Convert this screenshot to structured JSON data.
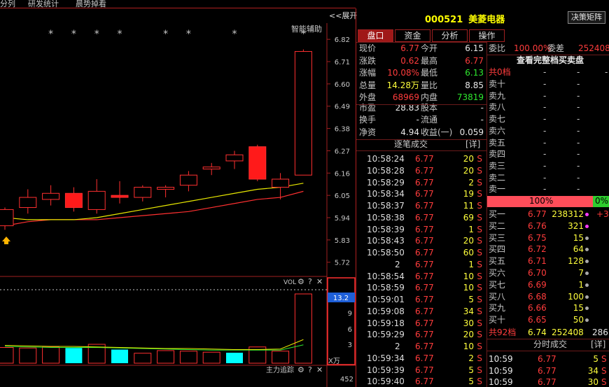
{
  "top_tabs": [
    "分列",
    "研发统计",
    "晨势掉看"
  ],
  "expand_label": "<<展开",
  "chart": {
    "assist_label": "智能辅助",
    "star": "*",
    "price_ticks": [
      "6.82",
      "6.71",
      "6.60",
      "6.49",
      "6.38",
      "6.27",
      "6.16",
      "6.05",
      "5.94",
      "5.83",
      "5.72"
    ],
    "vol_label": "VOL",
    "vol_ticks": [
      "13.2",
      "9",
      "6",
      "3"
    ],
    "vol_unit": "X万",
    "vol_icons": [
      "⚙",
      "?",
      "✕"
    ],
    "tracker_label": "主力追踪",
    "tracker_value": "452",
    "chart_data": {
      "type": "candlestick",
      "ylim": [
        5.65,
        6.9
      ],
      "price_ticks": [
        6.82,
        6.71,
        6.6,
        6.49,
        6.38,
        6.27,
        6.16,
        6.05,
        5.94,
        5.83,
        5.72
      ],
      "candles": [
        {
          "o": 5.9,
          "c": 5.98,
          "h": 5.99,
          "l": 5.88,
          "up": false
        },
        {
          "o": 6.04,
          "c": 5.99,
          "h": 6.08,
          "l": 5.96,
          "up": false
        },
        {
          "o": 6.06,
          "c": 6.03,
          "h": 6.1,
          "l": 6.0,
          "up": false
        },
        {
          "o": 6.06,
          "c": 5.99,
          "h": 6.09,
          "l": 5.97,
          "up": true
        },
        {
          "o": 6.07,
          "c": 5.98,
          "h": 6.13,
          "l": 5.96,
          "up": false
        },
        {
          "o": 6.05,
          "c": 6.04,
          "h": 6.12,
          "l": 6.01,
          "up": true
        },
        {
          "o": 6.09,
          "c": 6.04,
          "h": 6.1,
          "l": 6.02,
          "up": false
        },
        {
          "o": 6.09,
          "c": 6.08,
          "h": 6.1,
          "l": 6.04,
          "up": false
        },
        {
          "o": 6.15,
          "c": 6.1,
          "h": 6.17,
          "l": 6.07,
          "up": false
        },
        {
          "o": 6.19,
          "c": 6.18,
          "h": 6.21,
          "l": 6.15,
          "up": false
        },
        {
          "o": 6.25,
          "c": 6.22,
          "h": 6.27,
          "l": 6.18,
          "up": false
        },
        {
          "o": 6.29,
          "c": 6.13,
          "h": 6.3,
          "l": 6.12,
          "up": true
        },
        {
          "o": 6.13,
          "c": 6.09,
          "h": 6.16,
          "l": 6.03,
          "up": false
        },
        {
          "o": 6.15,
          "c": 6.76,
          "h": 6.77,
          "l": 6.15,
          "up": false
        }
      ],
      "stars_over": [
        2,
        3,
        4,
        5,
        7,
        8,
        10,
        13
      ],
      "ma_yellow": [
        5.94,
        5.93,
        5.93,
        5.93,
        5.94,
        5.96,
        5.98,
        6.0,
        6.02,
        6.04,
        6.06,
        6.08,
        6.09,
        6.11
      ],
      "ma_red": [
        5.9,
        5.92,
        5.93,
        5.93,
        5.93,
        5.94,
        5.95,
        5.96,
        5.97,
        5.99,
        6.01,
        6.03,
        6.04,
        6.07
      ],
      "vol_ylim": [
        0,
        14
      ],
      "volumes": [
        3.0,
        2.9,
        3.1,
        2.9,
        3.6,
        2.6,
        1.9,
        2.4,
        2.3,
        2.1,
        2.0,
        3.1,
        2.3,
        13.2
      ],
      "vol_cyan": [
        false,
        false,
        false,
        true,
        false,
        true,
        false,
        false,
        false,
        false,
        true,
        false,
        false,
        false
      ],
      "vol_ma_green": [
        3.2,
        3.1,
        3.0,
        3.0,
        3.0,
        2.9,
        2.8,
        2.7,
        2.6,
        2.5,
        2.5,
        2.5,
        2.5,
        3.5
      ],
      "vol_ma_yellow": [
        3.4,
        3.3,
        3.2,
        3.2,
        3.1,
        3.0,
        2.9,
        2.8,
        2.8,
        2.7,
        2.6,
        2.6,
        2.7,
        4.5
      ]
    }
  },
  "quote": {
    "code": "000521",
    "name": "美菱电器",
    "decision_btn": "决策矩阵",
    "tabs": [
      "盘口",
      "资金",
      "分析",
      "操作"
    ],
    "rows": [
      {
        "l1": "现价",
        "v1": "6.77",
        "c1": "red",
        "l2": "今开",
        "v2": "6.15",
        "c2": "white"
      },
      {
        "l1": "涨跌",
        "v1": "0.62",
        "c1": "red",
        "l2": "最高",
        "v2": "6.77",
        "c2": "red"
      },
      {
        "l1": "涨幅",
        "v1": "10.08%",
        "c1": "red",
        "l2": "最低",
        "v2": "6.13",
        "c2": "green"
      },
      {
        "l1": "总量",
        "v1": "14.28万",
        "c1": "yellow",
        "l2": "量比",
        "v2": "8.85",
        "c2": "white"
      },
      {
        "l1": "外盘",
        "v1": "68969",
        "c1": "red",
        "l2": "内盘",
        "v2": "73819",
        "c2": "green"
      }
    ],
    "rows2": [
      {
        "l1": "市盈",
        "v1": "28.83",
        "c1": "white",
        "l2": "股本",
        "v2": "-",
        "c2": "white"
      },
      {
        "l1": "换手",
        "v1": "-",
        "c1": "white",
        "l2": "流通",
        "v2": "-",
        "c2": "white"
      },
      {
        "l1": "净资",
        "v1": "4.94",
        "c1": "white",
        "l2": "收益(一)",
        "v2": "0.059",
        "c2": "white"
      }
    ],
    "trades_title": "逐笔成交",
    "detail_label": "[详]",
    "trades": [
      {
        "t": "10:58:24",
        "p": "6.77",
        "v": "20",
        "s": "S"
      },
      {
        "t": "10:58:28",
        "p": "6.77",
        "v": "20",
        "s": "S"
      },
      {
        "t": "10:58:29",
        "p": "6.77",
        "v": "2",
        "s": "S"
      },
      {
        "t": "10:58:34",
        "p": "6.77",
        "v": "19",
        "s": "S"
      },
      {
        "t": "10:58:37",
        "p": "6.77",
        "v": "11",
        "s": "S"
      },
      {
        "t": "10:58:38",
        "p": "6.77",
        "v": "69",
        "s": "S"
      },
      {
        "t": "10:58:39",
        "p": "6.77",
        "v": "1",
        "s": "S"
      },
      {
        "t": "10:58:43",
        "p": "6.77",
        "v": "20",
        "s": "S"
      },
      {
        "t": "10:58:50",
        "p": "6.77",
        "v": "60",
        "s": "S"
      },
      {
        "t": "2",
        "p": "6.77",
        "v": "1",
        "s": "S"
      },
      {
        "t": "10:58:54",
        "p": "6.77",
        "v": "10",
        "s": "S"
      },
      {
        "t": "10:58:59",
        "p": "6.77",
        "v": "10",
        "s": "S"
      },
      {
        "t": "10:59:01",
        "p": "6.77",
        "v": "5",
        "s": "S"
      },
      {
        "t": "10:59:08",
        "p": "6.77",
        "v": "34",
        "s": "S"
      },
      {
        "t": "10:59:18",
        "p": "6.77",
        "v": "30",
        "s": "S"
      },
      {
        "t": "10:59:29",
        "p": "6.77",
        "v": "20",
        "s": "S"
      },
      {
        "t": "2",
        "p": "6.77",
        "v": "10",
        "s": "S"
      },
      {
        "t": "10:59:34",
        "p": "6.77",
        "v": "2",
        "s": "S"
      },
      {
        "t": "10:59:39",
        "p": "6.77",
        "v": "5",
        "s": "S"
      },
      {
        "t": "10:59:40",
        "p": "6.77",
        "v": "5",
        "s": "S"
      }
    ]
  },
  "book": {
    "weibi_label": "委比",
    "weibi_val": "100.00%",
    "weicha_label": "委差",
    "weicha_val": "252408",
    "full_book": "查看完整档买卖盘",
    "sell_total_label": "共0档",
    "sells": [
      "卖十",
      "卖九",
      "卖八",
      "卖七",
      "卖六",
      "卖五",
      "卖四",
      "卖三",
      "卖二",
      "卖一"
    ],
    "dash": "-",
    "bar_left": "100%",
    "bar_right": "0%",
    "buys": [
      {
        "l": "买一",
        "p": "6.77",
        "v": "238312",
        "dot": "pk",
        "x": "+3"
      },
      {
        "l": "买二",
        "p": "6.76",
        "v": "321",
        "dot": "pk",
        "x": ""
      },
      {
        "l": "买三",
        "p": "6.75",
        "v": "15",
        "dot": "g",
        "x": ""
      },
      {
        "l": "买四",
        "p": "6.72",
        "v": "64",
        "dot": "g",
        "x": ""
      },
      {
        "l": "买五",
        "p": "6.71",
        "v": "128",
        "dot": "g",
        "x": ""
      },
      {
        "l": "买六",
        "p": "6.70",
        "v": "7",
        "dot": "g",
        "x": ""
      },
      {
        "l": "买七",
        "p": "6.69",
        "v": "1",
        "dot": "g",
        "x": ""
      },
      {
        "l": "买八",
        "p": "6.68",
        "v": "100",
        "dot": "g",
        "x": ""
      },
      {
        "l": "买九",
        "p": "6.66",
        "v": "15",
        "dot": "g",
        "x": ""
      },
      {
        "l": "买十",
        "p": "6.65",
        "v": "50",
        "dot": "g",
        "x": ""
      }
    ],
    "buy_total": {
      "l": "共92档",
      "p": "6.74",
      "v": "252408",
      "x": "286"
    },
    "ticks_title": "分时成交",
    "ticks_detail": "[详]",
    "ticks": [
      {
        "t": "10:59",
        "p": "6.77",
        "v": "5",
        "s": "S"
      },
      {
        "t": "10:59",
        "p": "6.77",
        "v": "34",
        "s": "S"
      },
      {
        "t": "10:59",
        "p": "6.77",
        "v": "30",
        "s": "S"
      }
    ]
  }
}
